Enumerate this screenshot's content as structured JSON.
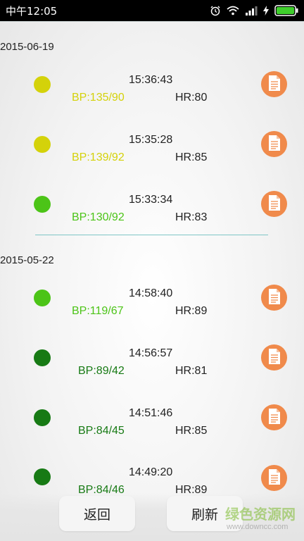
{
  "status_bar": {
    "time": "中午12:05",
    "icons": [
      "alarm-icon",
      "wifi-icon",
      "signal-icon",
      "charging-icon",
      "battery-icon"
    ]
  },
  "colors": {
    "yellow": "#d4d20a",
    "light_green": "#4cc417",
    "dark_green": "#177a14",
    "doc_button": "#f08a4b"
  },
  "groups": [
    {
      "date": "2015-06-19",
      "records": [
        {
          "time": "15:36:43",
          "bp": "BP:135/90",
          "hr": "HR:80",
          "level": "yellow"
        },
        {
          "time": "15:35:28",
          "bp": "BP:139/92",
          "hr": "HR:85",
          "level": "yellow"
        },
        {
          "time": "15:33:34",
          "bp": "BP:130/92",
          "hr": "HR:83",
          "level": "light_green"
        }
      ]
    },
    {
      "date": "2015-05-22",
      "records": [
        {
          "time": "14:58:40",
          "bp": "BP:119/67",
          "hr": "HR:89",
          "level": "light_green"
        },
        {
          "time": "14:56:57",
          "bp": "BP:89/42",
          "hr": "HR:81",
          "level": "dark_green"
        },
        {
          "time": "14:51:46",
          "bp": "BP:84/45",
          "hr": "HR:85",
          "level": "dark_green"
        },
        {
          "time": "14:49:20",
          "bp": "BP:84/46",
          "hr": "HR:89",
          "level": "dark_green"
        }
      ]
    }
  ],
  "bottom": {
    "back_label": "返回",
    "refresh_label": "刷新"
  },
  "watermark": {
    "text": "绿色资源网",
    "url": "www.downcc.com"
  }
}
